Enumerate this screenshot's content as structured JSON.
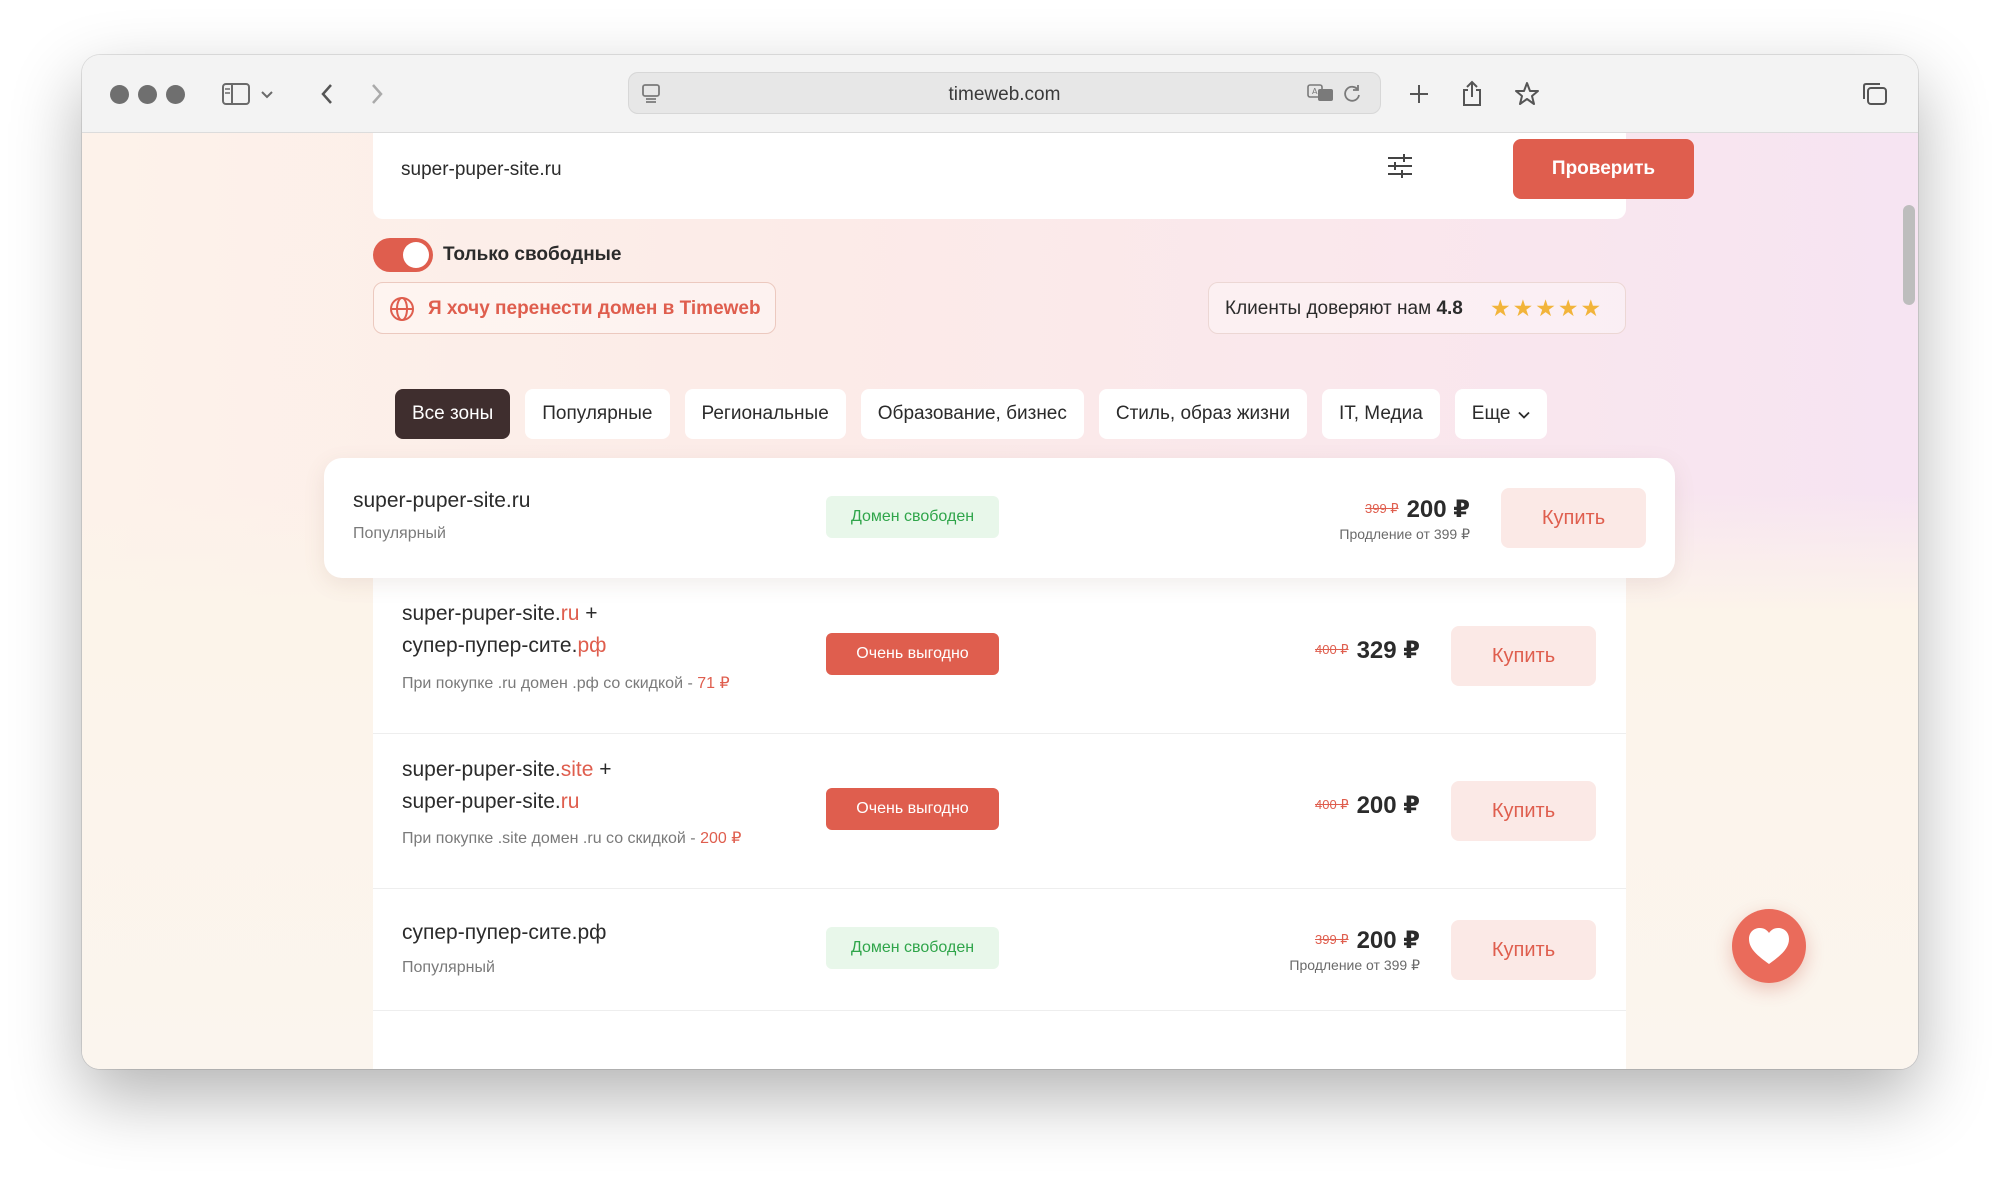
{
  "browser": {
    "url": "timeweb.com"
  },
  "search": {
    "value": "super-puper-site.ru",
    "check_label": "Проверить"
  },
  "toggle": {
    "label": "Только свободные",
    "on": true
  },
  "transfer": {
    "label": "Я хочу перенести домен в Timeweb"
  },
  "trust": {
    "label": "Клиенты доверяют нам",
    "rating": "4.8",
    "stars": "★★★★★"
  },
  "tabs": [
    {
      "label": "Все зоны",
      "active": true
    },
    {
      "label": "Популярные"
    },
    {
      "label": "Региональные"
    },
    {
      "label": "Образование, бизнес"
    },
    {
      "label": "Стиль, образ жизни"
    },
    {
      "label": "IT, Медиа"
    },
    {
      "label": "Еще"
    }
  ],
  "results": [
    {
      "domain": "super-puper-site.ru",
      "sub": "Популярный",
      "badge": "Домен свободен",
      "old_price": "399 ₽",
      "price": "200 ₽",
      "renew": "Продление от 399 ₽",
      "buy": "Купить"
    },
    {
      "line1_name": "super-puper-site.",
      "line1_zone": "ru",
      "line1_plus": " +",
      "line2_name": "супер-пупер-сите.",
      "line2_zone": "рф",
      "sub_text": "При покупке .ru домен .рф со скидкой - ",
      "sub_discount": "71 ₽",
      "badge": "Очень выгодно",
      "old_price": "400 ₽",
      "price": "329 ₽",
      "buy": "Купить"
    },
    {
      "line1_name": "super-puper-site.",
      "line1_zone": "site",
      "line1_plus": " +",
      "line2_name": "super-puper-site.",
      "line2_zone": "ru",
      "sub_text": "При покупке .site домен .ru со скидкой - ",
      "sub_discount": "200 ₽",
      "badge": "Очень выгодно",
      "old_price": "400 ₽",
      "price": "200 ₽",
      "buy": "Купить"
    },
    {
      "domain": "супер-пупер-сите.рф",
      "sub": "Популярный",
      "badge": "Домен свободен",
      "old_price": "399 ₽",
      "price": "200 ₽",
      "renew": "Продление от 399 ₽",
      "buy": "Купить"
    }
  ],
  "colors": {
    "accent": "#df5e4e",
    "free_badge_bg": "#e8f7ea",
    "free_badge_text": "#2fa54a",
    "active_tab": "#3f2e2e",
    "star": "#f2b43a"
  },
  "icons": {
    "chat": "heart-chat-icon",
    "transfer": "globe-icon",
    "filter": "sliders-icon"
  }
}
